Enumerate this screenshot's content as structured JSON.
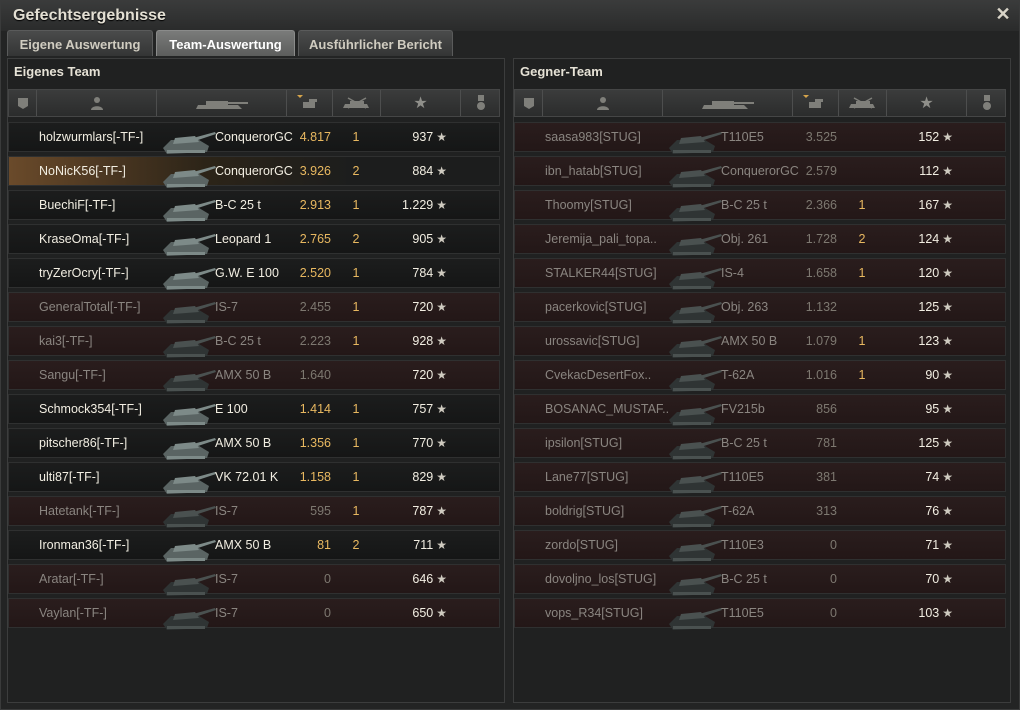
{
  "window": {
    "title": "Gefechtsergebnisse"
  },
  "tabs": [
    "Eigene Auswertung",
    "Team-Auswertung",
    "Ausführlicher Bericht"
  ],
  "active_tab": 1,
  "own_team": {
    "title": "Eigenes Team",
    "players": [
      {
        "name": "holzwurmlars[-TF-]",
        "tank": "ConquerorGC",
        "damage": "4.817",
        "kills": "1",
        "xp": "937",
        "alive": true,
        "me": false
      },
      {
        "name": "NoNicK56[-TF-]",
        "tank": "ConquerorGC",
        "damage": "3.926",
        "kills": "2",
        "xp": "884",
        "alive": true,
        "me": true
      },
      {
        "name": "BuechiF[-TF-]",
        "tank": "B-C 25 t",
        "damage": "2.913",
        "kills": "1",
        "xp": "1.229",
        "alive": true,
        "me": false
      },
      {
        "name": "KraseOma[-TF-]",
        "tank": "Leopard 1",
        "damage": "2.765",
        "kills": "2",
        "xp": "905",
        "alive": true,
        "me": false
      },
      {
        "name": "tryZerOcry[-TF-]",
        "tank": "G.W. E 100",
        "damage": "2.520",
        "kills": "1",
        "xp": "784",
        "alive": true,
        "me": false
      },
      {
        "name": "GeneralTotal[-TF-]",
        "tank": "IS-7",
        "damage": "2.455",
        "kills": "1",
        "xp": "720",
        "alive": false,
        "me": false
      },
      {
        "name": "kai3[-TF-]",
        "tank": "B-C 25 t",
        "damage": "2.223",
        "kills": "1",
        "xp": "928",
        "alive": false,
        "me": false
      },
      {
        "name": "Sangu[-TF-]",
        "tank": "AMX 50 B",
        "damage": "1.640",
        "kills": "",
        "xp": "720",
        "alive": false,
        "me": false
      },
      {
        "name": "Schmock354[-TF-]",
        "tank": "E 100",
        "damage": "1.414",
        "kills": "1",
        "xp": "757",
        "alive": true,
        "me": false
      },
      {
        "name": "pitscher86[-TF-]",
        "tank": "AMX 50 B",
        "damage": "1.356",
        "kills": "1",
        "xp": "770",
        "alive": true,
        "me": false
      },
      {
        "name": "ulti87[-TF-]",
        "tank": "VK 72.01 K",
        "damage": "1.158",
        "kills": "1",
        "xp": "829",
        "alive": true,
        "me": false
      },
      {
        "name": "Hatetank[-TF-]",
        "tank": "IS-7",
        "damage": "595",
        "kills": "1",
        "xp": "787",
        "alive": false,
        "me": false
      },
      {
        "name": "Ironman36[-TF-]",
        "tank": "AMX 50 B",
        "damage": "81",
        "kills": "2",
        "xp": "711",
        "alive": true,
        "me": false
      },
      {
        "name": "Aratar[-TF-]",
        "tank": "IS-7",
        "damage": "0",
        "kills": "",
        "xp": "646",
        "alive": false,
        "me": false
      },
      {
        "name": "Vaylan[-TF-]",
        "tank": "IS-7",
        "damage": "0",
        "kills": "",
        "xp": "650",
        "alive": false,
        "me": false
      }
    ]
  },
  "enemy_team": {
    "title": "Gegner-Team",
    "players": [
      {
        "name": "saasa983[STUG]",
        "tank": "T110E5",
        "damage": "3.525",
        "kills": "",
        "xp": "152",
        "alive": false,
        "me": false
      },
      {
        "name": "ibn_hatab[STUG]",
        "tank": "ConquerorGC",
        "damage": "2.579",
        "kills": "",
        "xp": "112",
        "alive": false,
        "me": false
      },
      {
        "name": "Thoomy[STUG]",
        "tank": "B-C 25 t",
        "damage": "2.366",
        "kills": "1",
        "xp": "167",
        "alive": false,
        "me": false
      },
      {
        "name": "Jeremija_pali_topa..",
        "tank": "Obj. 261",
        "damage": "1.728",
        "kills": "2",
        "xp": "124",
        "alive": false,
        "me": false
      },
      {
        "name": "STALKER44[STUG]",
        "tank": "IS-4",
        "damage": "1.658",
        "kills": "1",
        "xp": "120",
        "alive": false,
        "me": false
      },
      {
        "name": "pacerkovic[STUG]",
        "tank": "Obj. 263",
        "damage": "1.132",
        "kills": "",
        "xp": "125",
        "alive": false,
        "me": false
      },
      {
        "name": "urossavic[STUG]",
        "tank": "AMX 50 B",
        "damage": "1.079",
        "kills": "1",
        "xp": "123",
        "alive": false,
        "me": false
      },
      {
        "name": "CvekacDesertFox..",
        "tank": "T-62A",
        "damage": "1.016",
        "kills": "1",
        "xp": "90",
        "alive": false,
        "me": false
      },
      {
        "name": "BOSANAC_MUSTAF..",
        "tank": "FV215b",
        "damage": "856",
        "kills": "",
        "xp": "95",
        "alive": false,
        "me": false
      },
      {
        "name": "ipsilon[STUG]",
        "tank": "B-C 25 t",
        "damage": "781",
        "kills": "",
        "xp": "125",
        "alive": false,
        "me": false
      },
      {
        "name": "Lane77[STUG]",
        "tank": "T110E5",
        "damage": "381",
        "kills": "",
        "xp": "74",
        "alive": false,
        "me": false
      },
      {
        "name": "boldrig[STUG]",
        "tank": "T-62A",
        "damage": "313",
        "kills": "",
        "xp": "76",
        "alive": false,
        "me": false
      },
      {
        "name": "zordo[STUG]",
        "tank": "T110E3",
        "damage": "0",
        "kills": "",
        "xp": "71",
        "alive": false,
        "me": false
      },
      {
        "name": "dovoljno_los[STUG]",
        "tank": "B-C 25 t",
        "damage": "0",
        "kills": "",
        "xp": "70",
        "alive": false,
        "me": false
      },
      {
        "name": "vops_R34[STUG]",
        "tank": "T110E5",
        "damage": "0",
        "kills": "",
        "xp": "103",
        "alive": false,
        "me": false
      }
    ]
  },
  "columns": [
    {
      "icon": "squad-icon"
    },
    {
      "icon": "player-icon"
    },
    {
      "icon": "tank-icon"
    },
    {
      "icon": "damage-icon",
      "sorted": true
    },
    {
      "icon": "kills-icon"
    },
    {
      "icon": "star-icon"
    },
    {
      "icon": "medal-icon"
    }
  ],
  "colors": {
    "damage": "#e8b860",
    "highlight": "#6a4a2a",
    "dead_row": "#2a1d1d"
  }
}
